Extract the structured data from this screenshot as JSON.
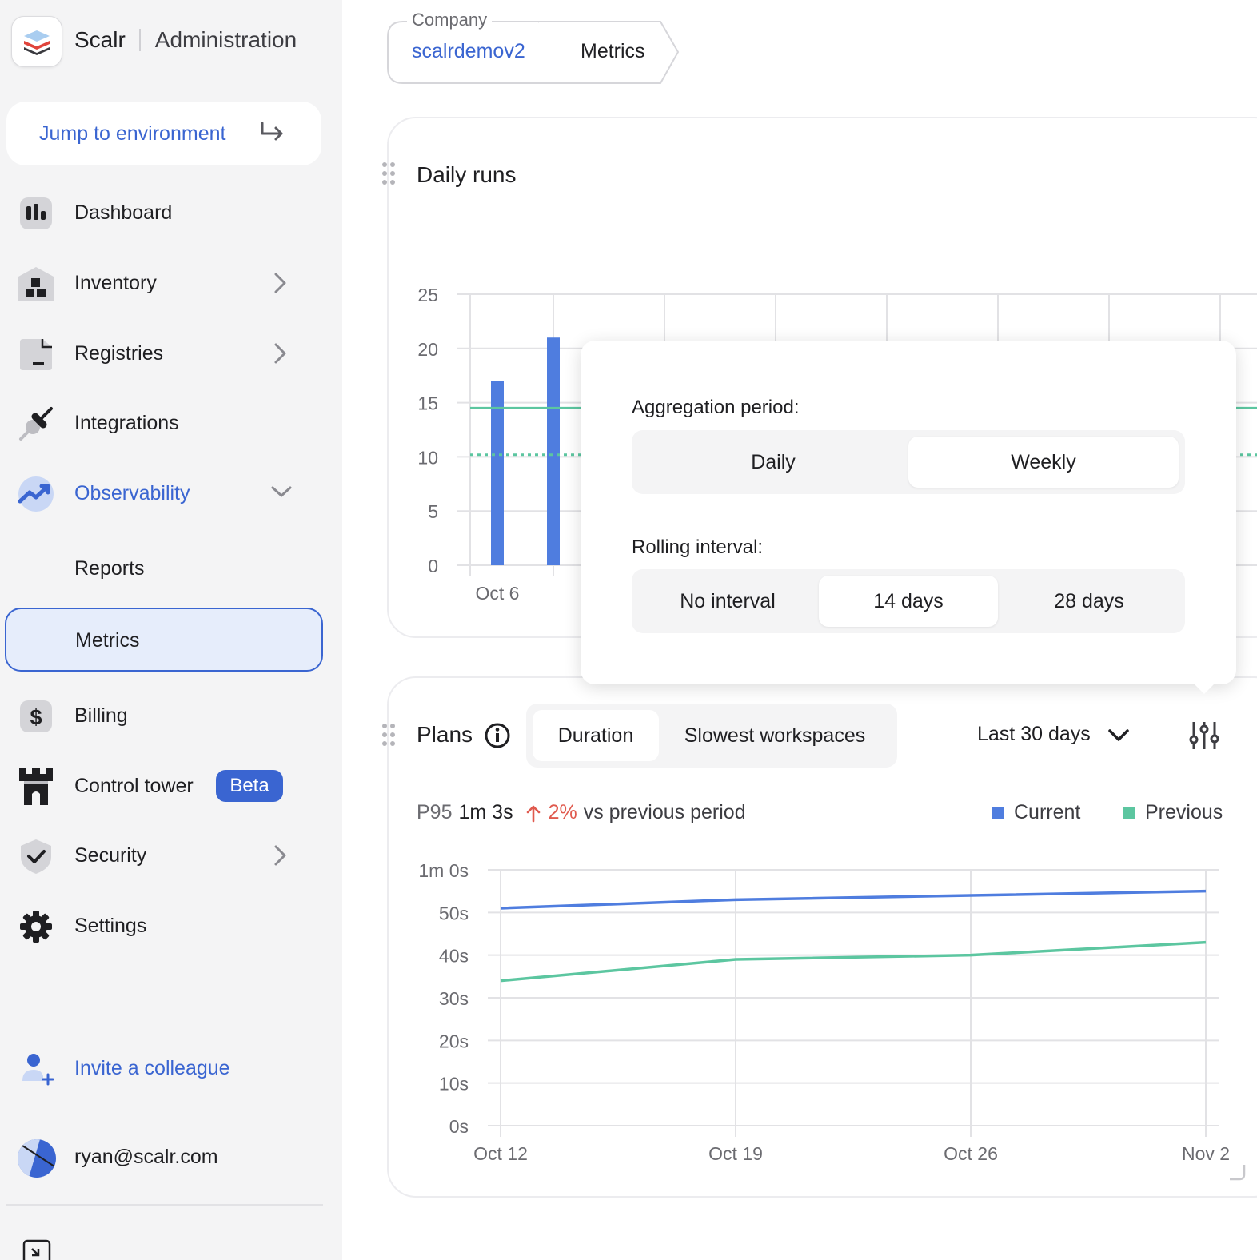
{
  "app": {
    "brand": "Scalr",
    "section": "Administration"
  },
  "jump": {
    "label": "Jump to environment"
  },
  "nav": {
    "dashboard": "Dashboard",
    "inventory": "Inventory",
    "registries": "Registries",
    "integrations": "Integrations",
    "observability": "Observability",
    "reports": "Reports",
    "metrics": "Metrics",
    "billing": "Billing",
    "control_tower": "Control tower",
    "beta": "Beta",
    "security": "Security",
    "settings": "Settings",
    "invite": "Invite a colleague",
    "user_email": "ryan@scalr.com"
  },
  "breadcrumb": {
    "label": "Company",
    "company": "scalrdemov2",
    "page": "Metrics"
  },
  "daily_runs": {
    "title": "Daily runs"
  },
  "popover": {
    "aggregation_label": "Aggregation period:",
    "aggregation_options": [
      "Daily",
      "Weekly"
    ],
    "aggregation_selected": "Weekly",
    "rolling_label": "Rolling interval:",
    "rolling_options": [
      "No interval",
      "14 days",
      "28 days"
    ],
    "rolling_selected": "14 days"
  },
  "plans": {
    "title": "Plans",
    "tabs": [
      "Duration",
      "Slowest workspaces"
    ],
    "tab_selected": "Duration",
    "range": "Last 30 days",
    "stat_prefix": "P95",
    "stat_value": "1m 3s",
    "stat_change": "2%",
    "stat_suffix": "vs previous period",
    "legend_current": "Current",
    "legend_previous": "Previous"
  },
  "colors": {
    "accent": "#3a65d1",
    "current": "#4f7ddf",
    "previous": "#5cc6a0",
    "up": "#e05a4e"
  },
  "chart_data": [
    {
      "type": "bar",
      "title": "Daily runs",
      "categories": [
        "Oct 6",
        ""
      ],
      "values": [
        17,
        21
      ],
      "ylim": [
        0,
        25
      ],
      "yticks": [
        0,
        5,
        10,
        15,
        20,
        25
      ],
      "xtick_labels": [
        "Oct 6"
      ],
      "reference_lines": [
        {
          "value": 14.5,
          "style": "solid"
        },
        {
          "value": 10.2,
          "style": "dotted"
        }
      ],
      "grid": true
    },
    {
      "type": "line",
      "title": "Plans",
      "categories": [
        "Oct 12",
        "Oct 19",
        "Oct 26",
        "Nov 2"
      ],
      "yticks": [
        "0s",
        "10s",
        "20s",
        "30s",
        "40s",
        "50s",
        "1m 0s"
      ],
      "ylim": [
        0,
        60
      ],
      "series": [
        {
          "name": "Current",
          "values": [
            51,
            53,
            54,
            55
          ]
        },
        {
          "name": "Previous",
          "values": [
            34,
            39,
            40,
            43
          ]
        }
      ],
      "grid": true,
      "legend": "top-right"
    }
  ]
}
